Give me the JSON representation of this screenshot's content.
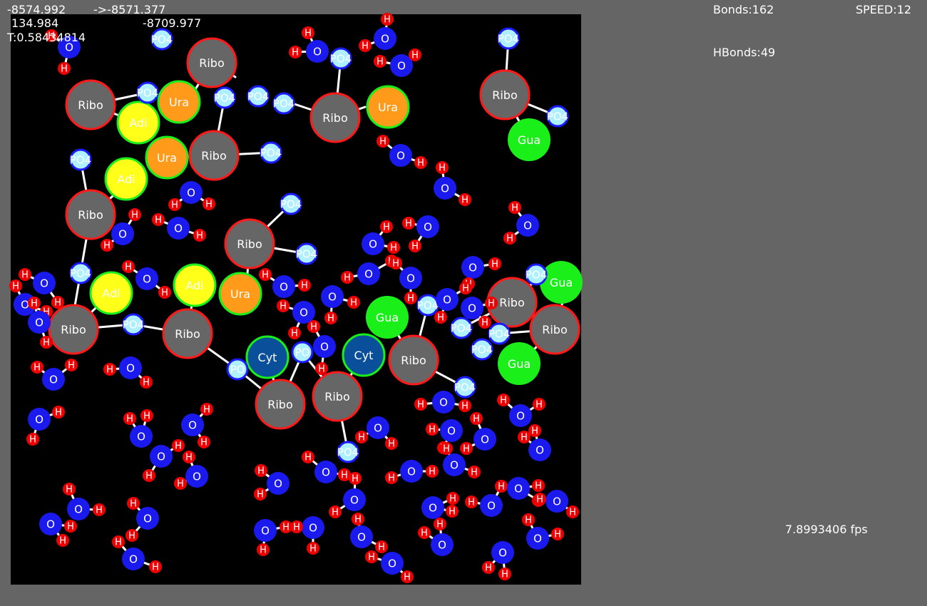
{
  "hud": {
    "coord_x": "-8574.992",
    "arrow_readout": "->-8571.377",
    "coord_y": "134.984",
    "coord_z": "-8709.977",
    "time": "T:0.58434814",
    "bonds": "Bonds:162",
    "hbonds": "HBonds:49",
    "speed": "SPEED:12",
    "fps": "7.8993406 fps"
  },
  "colors": {
    "background": "#656565",
    "canvas": "#000000",
    "ribose_fill": "#666666",
    "ribose_ring": "#ff1a1a",
    "phosphate": "#aef0ff",
    "phosphate_ring": "#1a1aff",
    "adenine": "#ffff1a",
    "uracil": "#ff9a1a",
    "guanine": "#1aef1a",
    "cytosine": "#0a4f9a",
    "base_ring": "#1aef1a",
    "oxygen": "#1a1aee",
    "hydrogen": "#ee0000",
    "bond": "#ffffff"
  },
  "labels": {
    "ribose": "Ribo",
    "phosphate": "PO4",
    "phosphate_short": "PO",
    "adenine": "Adi",
    "uracil": "Ura",
    "guanine": "Gua",
    "cytosine": "Cyt",
    "oxygen": "O",
    "hydrogen": "H"
  }
}
